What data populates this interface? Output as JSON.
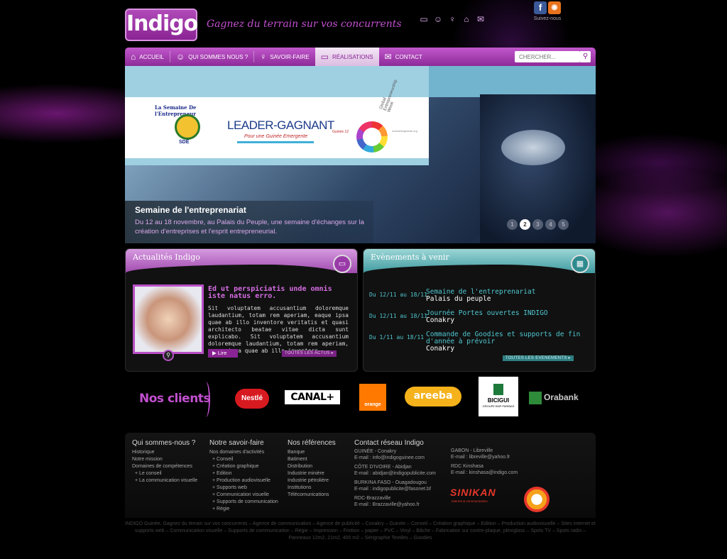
{
  "header": {
    "logo_text": "Indigo",
    "tagline": "Gagnez du terrain sur vos concurrents",
    "social_label": "Suivez-nous",
    "top_icons": [
      "screen-icon",
      "team-icon",
      "bulb-icon",
      "home-icon",
      "mail-icon"
    ]
  },
  "nav": {
    "items": [
      {
        "label": "ACCUEIL",
        "icon": "home-icon"
      },
      {
        "label": "QUI SOMMES NOUS ?",
        "icon": "team-icon"
      },
      {
        "label": "SAVOIR-FAIRE",
        "icon": "bulb-icon"
      },
      {
        "label": "RÉALISATIONS",
        "icon": "screen-icon",
        "active": true
      },
      {
        "label": "CONTACT",
        "icon": "mail-icon"
      }
    ],
    "search_placeholder": "CHERCHER..."
  },
  "hero": {
    "banner_sde_text": "La Semaine De l'Entrepreneur",
    "banner_sde_abbr": "SDE",
    "banner_leader": "LEADER-GAGNANT",
    "banner_leader_sub": "Pour une Guinée Emergente",
    "banner_guinee": "Guinée 12",
    "banner_gew": "Global Entrepreneurship Week",
    "banner_url": "unleashingideas.org",
    "title": "Semaine de l'entreprenariat",
    "text": "Du 12 au 18 novembre, au Palais du Peuple, une semaine d'échanges sur la création d'entreprises et l'esprit entrepreneurial.",
    "pages": [
      "1",
      "2",
      "3",
      "4",
      "5"
    ],
    "active_page": "2"
  },
  "news": {
    "title": "Actualités Indigo",
    "headline": "Ed ut perspiciatis unde omnis iste natus erro.",
    "body": "Sit voluptatem accusantium doloremque laudantium, totam rem aperiam, eaque ipsa quae ab illo inventore veritatis et quasi architecto beatae vitae dicta sunt explicabo. Sit voluptatem accusantium doloremque laudantium, totam rem aperiam, eaque ipsa quae ab illo inventore.",
    "read_label": "Lire",
    "all_label": "TOUTES LES ACTUS"
  },
  "events": {
    "title": "Evènements à venir",
    "items": [
      {
        "date": "Du 12/11 au 18/11",
        "title": "Semaine de l'entreprenariat",
        "place": "Palais du peuple"
      },
      {
        "date": "Du 12/11 au 18/11",
        "title": "Journée Portes ouvertes INDIGO",
        "place": "Conakry"
      },
      {
        "date": "Du 1/11 au 18/11",
        "title": "Commande de Goodies et supports de fin d'année à prévoir",
        "place": "Conakry"
      }
    ],
    "all_label": "TOUTES LES EVENEMENTS"
  },
  "clients": {
    "label": "Nos clients",
    "logos": [
      "Nestlé",
      "CANAL+",
      "orange",
      "areeba",
      "BICIGUI",
      "GROUPE BNP PARIBAS",
      "Orabank"
    ]
  },
  "footer": {
    "col1": {
      "title": "Qui sommes-nous ?",
      "items": [
        "Historique",
        "Notre mission",
        "Domaines de compétences",
        "+ Le conseil",
        "+ La communication visuelle"
      ]
    },
    "col2": {
      "title": "Notre savoir-faire",
      "items": [
        "Nos domaines d'activités",
        "+ Conseil",
        "+ Création graphique",
        "+ Edition",
        "+ Production audiovisuelle",
        "+ Supports web",
        "+ Communication visuelle",
        "+ Supports de communication",
        "+ Régie"
      ]
    },
    "col3": {
      "title": "Nos références",
      "items": [
        "Banque",
        "Batiment",
        "Distribution",
        "Industrie minière",
        "Industrie pétrolière",
        "Institutions",
        "Télécomunications"
      ]
    },
    "col4": {
      "title": "Contact réseau Indigo",
      "blocks": [
        {
          "line1": "GUINÉE - Conakry",
          "line2": "E-mail : info@indigoguinee.com"
        },
        {
          "line1": "CÔTE D'IVOIRE - Abidjan",
          "line2": "E-mail : abidjan@indigopublicite.com"
        },
        {
          "line1": "BURKINA FASO - Ouagadougou",
          "line2": "E-mail : indigopublicite@fasonet.bf"
        },
        {
          "line1": "RDC-Brazzaville",
          "line2": "E-mail : Brazzaville@yahoo.fr"
        }
      ]
    },
    "col5": {
      "blocks": [
        {
          "line1": "GABON - Libreville",
          "line2": "E-mail : libreville@yahoo.fr"
        },
        {
          "line1": "RDC Kinshasa",
          "line2": "E-mail : kinshasa@indigo.com"
        }
      ]
    },
    "sinikan": "SINIKAN",
    "sinikan_sub": "internet & communication",
    "note": "INDIGO Guinée, Gagnez du terrain sur vos concurrents – Agence de communication – Agence de publicité – Conakry – Guinée – Conseil – Création graphique – Edition – Production audiovisuelle – Sites internet et supports web – Communication visuelle – Supports de communication – Régie – Impression – Finition – papier – PVC – Vinyl – Bâche – Fabrication sur contre-plaque, plexiglass – Spots TV – Spots radio – Panneaux 12m2, 21m2, 400 m2 – Sérigraphie Textiles – Goodies"
  },
  "colors": {
    "brand_purple": "#8a2494",
    "accent_teal": "#4fc7d0"
  }
}
